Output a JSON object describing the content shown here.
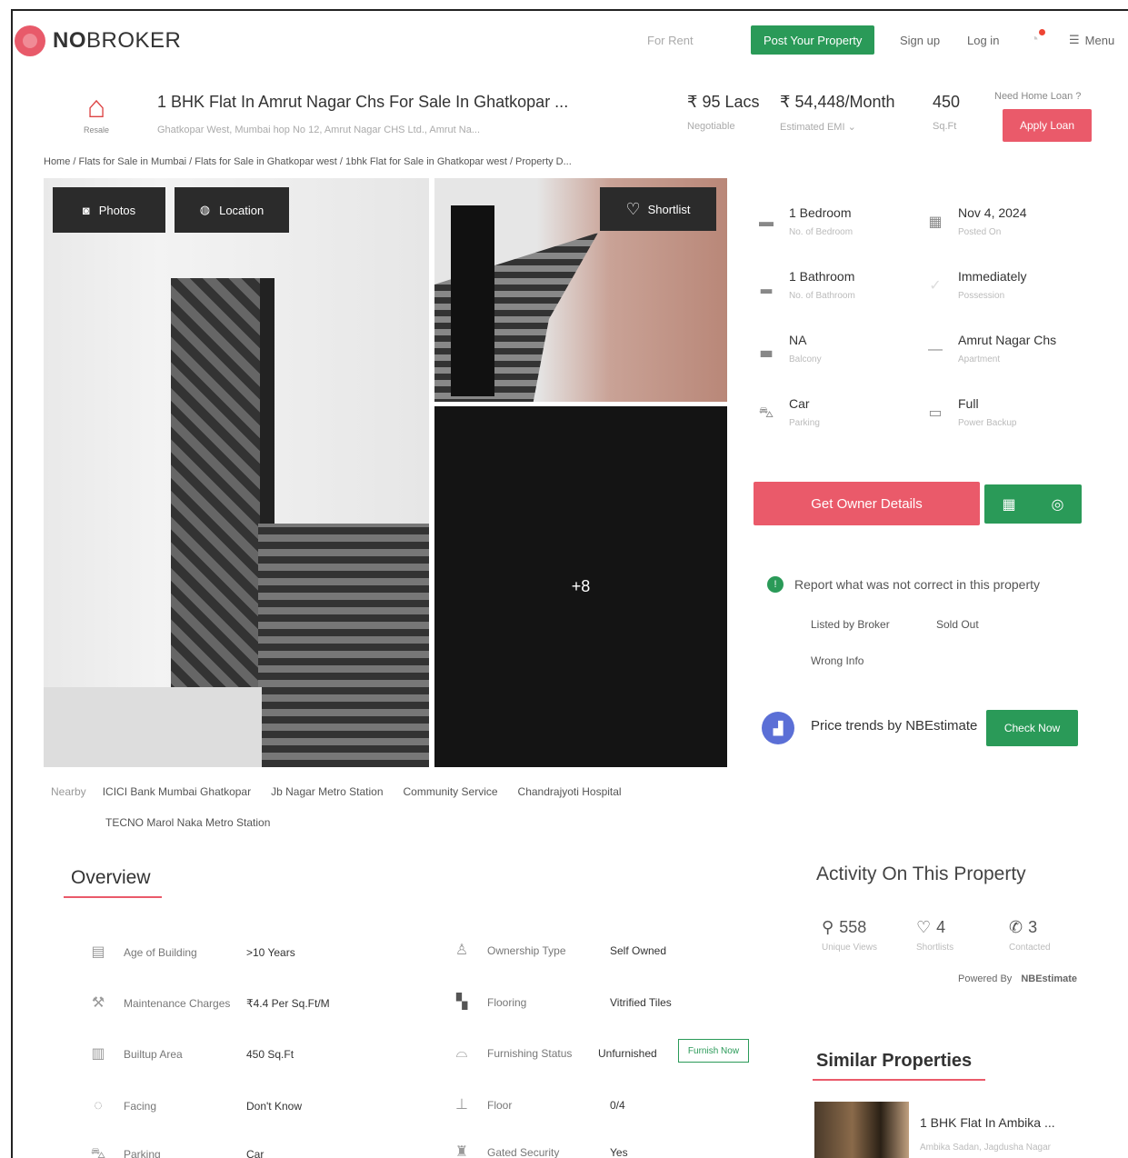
{
  "brand": {
    "logo_bold": "NO",
    "logo_rest": "BROKER"
  },
  "nav": {
    "rent": "For Rent",
    "post": "Post Your Property",
    "signup": "Sign up",
    "login": "Log in",
    "menu": "Menu"
  },
  "listing": {
    "badge": "Resale",
    "title": "1 BHK Flat In Amrut Nagar Chs For Sale In Ghatkopar ...",
    "subtitle": "Ghatkopar West, Mumbai hop No 12, Amrut Nagar CHS Ltd., Amrut Na...",
    "price": "₹ 95 Lacs",
    "price_label": "Negotiable",
    "emi": "₹ 54,448/Month",
    "emi_label": "Estimated EMI",
    "area": "450",
    "area_label": "Sq.Ft",
    "loan_question": "Need Home Loan ?",
    "loan_button": "Apply Loan"
  },
  "breadcrumb": "Home / Flats for Sale in Mumbai / Flats for Sale in Ghatkopar west / 1bhk Flat for Sale in Ghatkopar west / Property D...",
  "gallery": {
    "photos": "Photos",
    "location": "Location",
    "shortlist": "Shortlist",
    "more": "+8"
  },
  "nearby": {
    "label": "Nearby",
    "items": [
      "ICICI Bank Mumbai Ghatkopar",
      "Jb Nagar Metro Station",
      "Community Service",
      "Chandrajyoti Hospital",
      "TECNO Marol Naka Metro Station"
    ]
  },
  "specs": [
    {
      "value": "1 Bedroom",
      "label": "No. of Bedroom",
      "icon": "bed-icon"
    },
    {
      "value": "Nov 4, 2024",
      "label": "Posted On",
      "icon": "calendar-icon"
    },
    {
      "value": "1 Bathroom",
      "label": "No. of Bathroom",
      "icon": "bath-icon"
    },
    {
      "value": "Immediately",
      "label": "Possession",
      "icon": "key-icon"
    },
    {
      "value": "NA",
      "label": "Balcony",
      "icon": "sofa-icon"
    },
    {
      "value": "Amrut Nagar Chs",
      "label": "Apartment",
      "icon": "building-icon"
    },
    {
      "value": "Car",
      "label": "Parking",
      "icon": "car-icon"
    },
    {
      "value": "Full",
      "label": "Power Backup",
      "icon": "battery-icon"
    }
  ],
  "actions": {
    "owner": "Get Owner Details"
  },
  "report": {
    "text": "Report what was not correct in this property",
    "options": [
      "Listed by Broker",
      "Sold Out",
      "Wrong Info"
    ]
  },
  "trend": {
    "text": "Price trends by NBEstimate",
    "button": "Check Now"
  },
  "overview": {
    "title": "Overview",
    "left": [
      {
        "key": "Age of Building",
        "value": ">10 Years",
        "icon": "building-age-icon"
      },
      {
        "key": "Maintenance Charges",
        "value": "₹4.4 Per Sq.Ft/M",
        "icon": "maintenance-icon"
      },
      {
        "key": "Builtup Area",
        "value": "450 Sq.Ft",
        "icon": "area-icon"
      },
      {
        "key": "Facing",
        "value": "Don't Know",
        "icon": "compass-icon"
      },
      {
        "key": "Parking",
        "value": "Car",
        "icon": "car-icon"
      }
    ],
    "right": [
      {
        "key": "Ownership Type",
        "value": "Self Owned",
        "icon": "ownership-icon"
      },
      {
        "key": "Flooring",
        "value": "Vitrified Tiles",
        "icon": "flooring-icon"
      },
      {
        "key": "Furnishing Status",
        "value": "Unfurnished",
        "icon": "sofa-icon"
      },
      {
        "key": "Floor",
        "value": "0/4",
        "icon": "floor-icon"
      },
      {
        "key": "Gated Security",
        "value": "Yes",
        "icon": "security-icon"
      }
    ],
    "furnish_button": "Furnish Now"
  },
  "activity": {
    "title": "Activity On This Property",
    "stats": [
      {
        "value": "558",
        "label": "Unique Views",
        "icon": "user-icon"
      },
      {
        "value": "4",
        "label": "Shortlists",
        "icon": "heart-icon"
      },
      {
        "value": "3",
        "label": "Contacted",
        "icon": "phone-icon"
      }
    ],
    "powered_by": "Powered By",
    "powered_name": "NBEstimate"
  },
  "similar": {
    "title": "Similar Properties",
    "item_title": "1 BHK Flat In Ambika ...",
    "item_sub": "Ambika Sadan, Jagdusha Nagar"
  }
}
